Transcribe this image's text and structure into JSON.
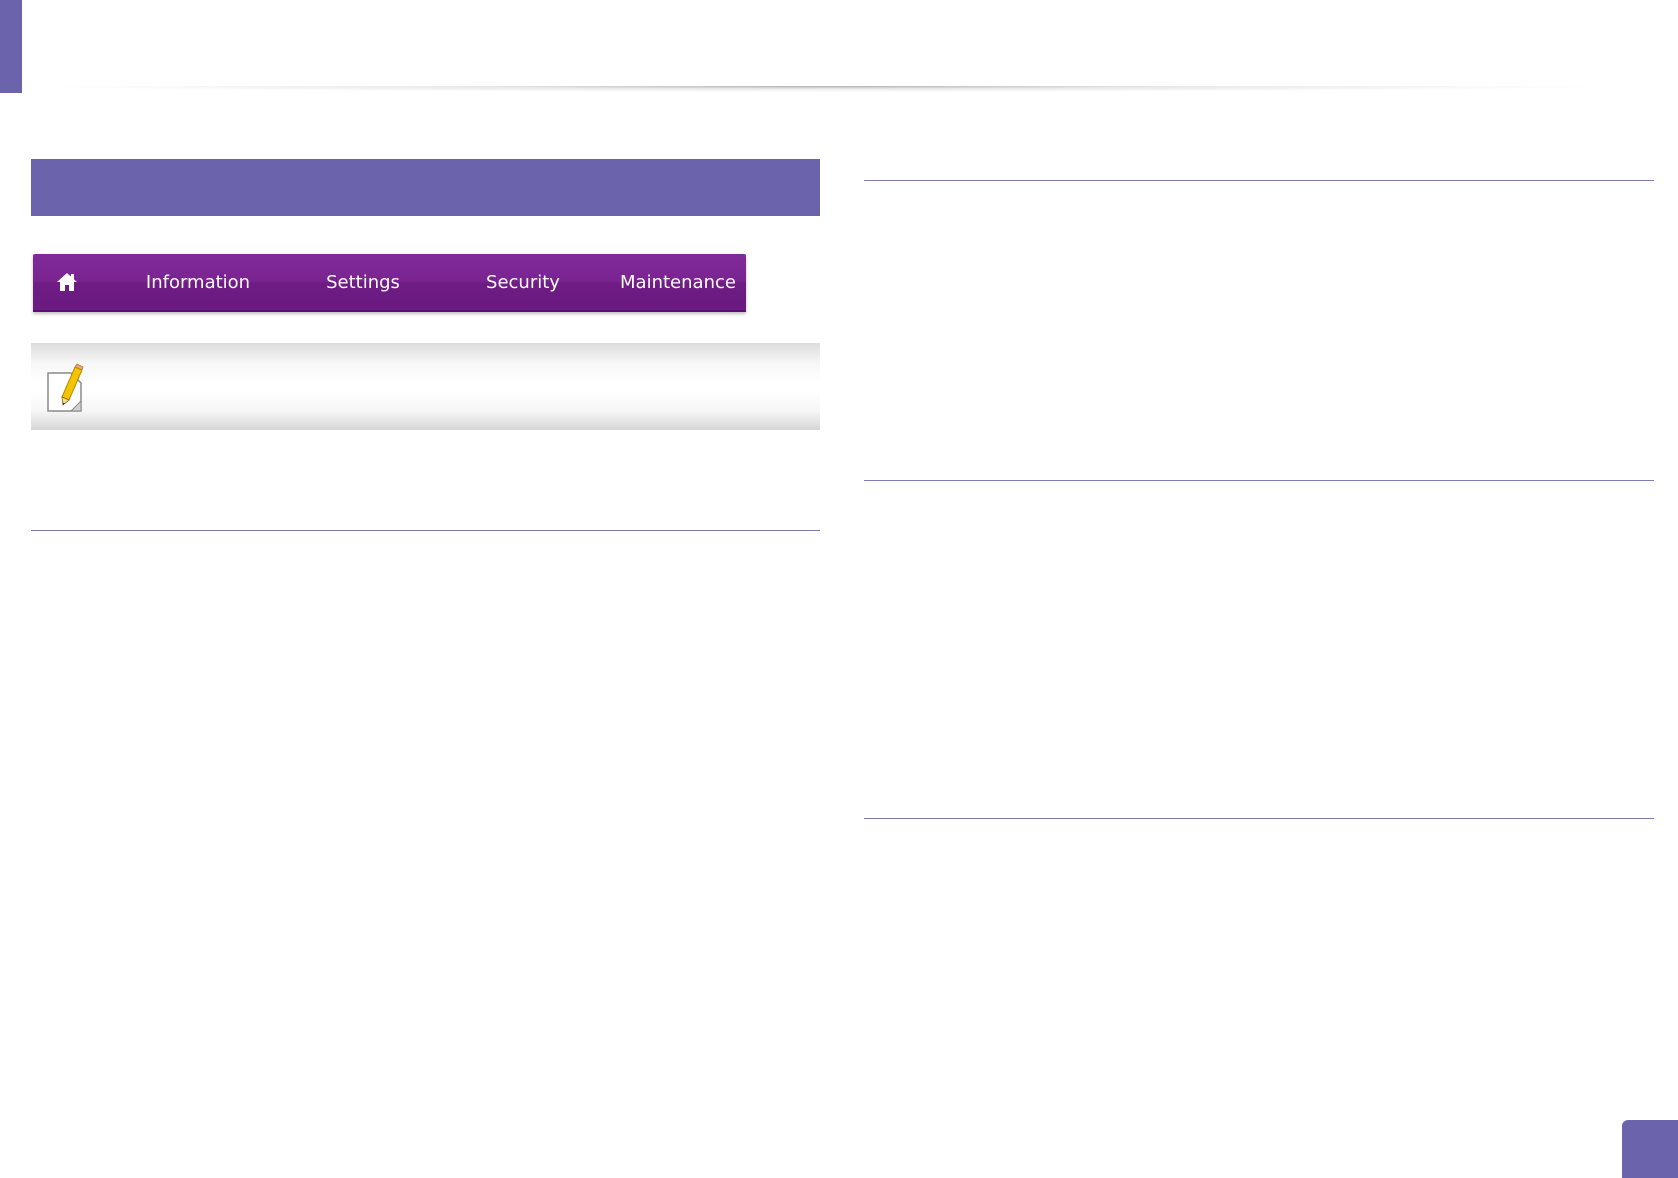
{
  "theme": {
    "accent": "#6b64ad",
    "nav_background": "#7a2492",
    "rule_color": "#7f7bb5"
  },
  "nav": {
    "home_icon": "home-icon",
    "items": [
      {
        "label": "Information"
      },
      {
        "label": "Settings"
      },
      {
        "label": "Security"
      },
      {
        "label": "Maintenance"
      }
    ]
  },
  "note": {
    "icon": "note-pencil-icon"
  }
}
